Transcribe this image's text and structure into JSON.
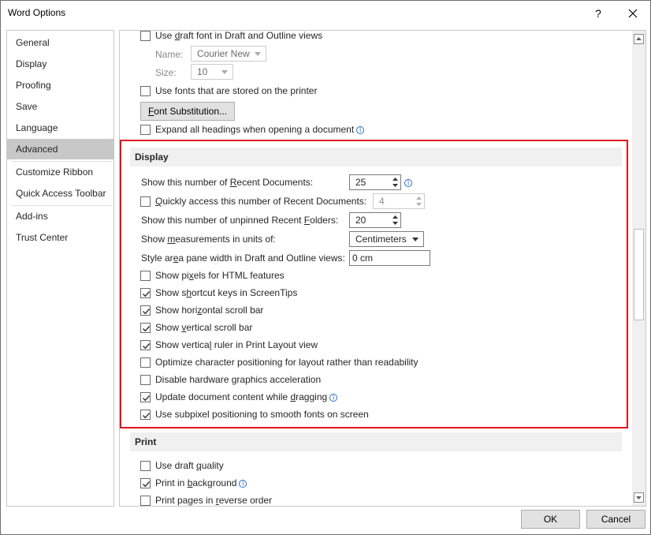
{
  "window": {
    "title": "Word Options",
    "help_label": "?"
  },
  "sidebar": {
    "items": [
      {
        "label": "General"
      },
      {
        "label": "Display"
      },
      {
        "label": "Proofing"
      },
      {
        "label": "Save"
      },
      {
        "label": "Language"
      },
      {
        "label": "Advanced"
      },
      {
        "label": "Customize Ribbon"
      },
      {
        "label": "Quick Access Toolbar"
      },
      {
        "label": "Add-ins"
      },
      {
        "label": "Trust Center"
      }
    ],
    "selected": "Advanced"
  },
  "top_options": {
    "draft_font": {
      "label_pre": "Use ",
      "label_ul": "d",
      "label_post": "raft font in Draft and Outline views",
      "checked": false
    },
    "name_label": "Name:",
    "name_value": "Courier New",
    "size_label": "Size:",
    "size_value": "10",
    "printer_fonts": {
      "label": "Use fonts that are stored on the printer",
      "checked": false
    },
    "font_sub_pre": "F",
    "font_sub_post": "ont Substitution...",
    "expand_headings": {
      "label": "Expand all headings when opening a document",
      "checked": false
    }
  },
  "display": {
    "header": "Display",
    "recent_docs_pre": "Show this number of ",
    "recent_docs_ul": "R",
    "recent_docs_post": "ecent Documents:",
    "recent_docs_value": "25",
    "quick_access_ul": "Q",
    "quick_access_post": "uickly access this number of Recent Documents:",
    "quick_access_checked": false,
    "quick_access_value": "4",
    "unpinned_pre": "Show this number of unpinned Recent ",
    "unpinned_ul": "F",
    "unpinned_post": "olders:",
    "unpinned_value": "20",
    "units_pre": "Show ",
    "units_ul": "m",
    "units_post": "easurements in units of:",
    "units_value": "Centimeters",
    "style_pre": "Style ar",
    "style_ul": "e",
    "style_post": "a pane width in Draft and Outline views:",
    "style_value": "0 cm",
    "checkboxes": [
      {
        "pre": "Show pi",
        "ul": "x",
        "post": "els for HTML features",
        "checked": false,
        "info": false
      },
      {
        "pre": "Show s",
        "ul": "h",
        "post": "ortcut keys in ScreenTips",
        "checked": true,
        "info": false
      },
      {
        "pre": "Show hori",
        "ul": "z",
        "post": "ontal scroll bar",
        "checked": true,
        "info": false
      },
      {
        "pre": "Show ",
        "ul": "v",
        "post": "ertical scroll bar",
        "checked": true,
        "info": false
      },
      {
        "pre": "Show vertica",
        "ul": "l",
        "post": " ruler in Print Layout view",
        "checked": true,
        "info": false
      },
      {
        "pre": "Optimize character positioning for layout rather than readability",
        "ul": "",
        "post": "",
        "checked": false,
        "info": false
      },
      {
        "pre": "Disable hardware ",
        "ul": "g",
        "post": "raphics acceleration",
        "checked": false,
        "info": false
      },
      {
        "pre": "Update document content while ",
        "ul": "d",
        "post": "ragging",
        "checked": true,
        "info": true
      },
      {
        "pre": "Use subpixel positioning to smooth fonts on screen",
        "ul": "",
        "post": "",
        "checked": true,
        "info": false
      }
    ]
  },
  "print": {
    "header": "Print",
    "checkboxes": [
      {
        "pre": "Use draft ",
        "ul": "q",
        "post": "uality",
        "checked": false,
        "info": false
      },
      {
        "pre": "Print in ",
        "ul": "b",
        "post": "ackground",
        "checked": true,
        "info": true
      },
      {
        "pre": "Print pages in ",
        "ul": "r",
        "post": "everse order",
        "checked": false,
        "info": false
      }
    ]
  },
  "footer": {
    "ok_label": "OK",
    "cancel_label": "Cancel"
  },
  "colors": {
    "highlight": "#e0141e",
    "selected_nav": "#c8c8c8",
    "info": "#2b6fc6"
  }
}
